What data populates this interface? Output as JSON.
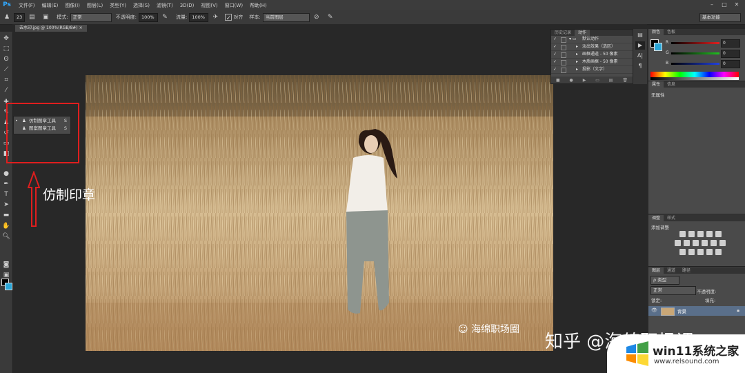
{
  "app": {
    "logo": "Ps"
  },
  "menu": [
    "文件(F)",
    "编辑(E)",
    "图像(I)",
    "图层(L)",
    "类型(Y)",
    "选择(S)",
    "滤镜(T)",
    "3D(D)",
    "视图(V)",
    "窗口(W)",
    "帮助(H)"
  ],
  "options": {
    "brush_size": "23",
    "mode_label": "模式:",
    "mode_value": "正常",
    "opacity_label": "不透明度:",
    "opacity_value": "100%",
    "flow_label": "流量:",
    "flow_value": "100%",
    "aligned_label": "对齐",
    "sample_label": "样本:",
    "sample_value": "当前图层",
    "workspace": "基本功能"
  },
  "document": {
    "tab_title": "去水印.jpg @ 100%(RGB/8#)"
  },
  "flyout": {
    "items": [
      {
        "name": "仿制图章工具",
        "key": "S",
        "selected": true
      },
      {
        "name": "图案图章工具",
        "key": "S",
        "selected": false
      }
    ]
  },
  "annotation": {
    "label": "仿制印章"
  },
  "actions_panel": {
    "tabs": [
      "历史记录",
      "动作"
    ],
    "items": [
      {
        "name": "默认动作",
        "expanded": true
      },
      {
        "name": "淡出效果（选区）"
      },
      {
        "name": "画框通道 - 50 像素"
      },
      {
        "name": "木质画框 - 50 像素"
      },
      {
        "name": "投影（文字）"
      }
    ]
  },
  "color_panel": {
    "tabs": [
      "颜色",
      "色板"
    ],
    "channels": [
      {
        "label": "R",
        "value": "0",
        "color": "#e02020"
      },
      {
        "label": "G",
        "value": "0",
        "color": "#20c020"
      },
      {
        "label": "B",
        "value": "0",
        "color": "#2040e0"
      }
    ]
  },
  "properties_panel": {
    "tabs": [
      "属性",
      "信息"
    ],
    "content": "无属性"
  },
  "adjustments_panel": {
    "tabs": [
      "调整",
      "样式"
    ],
    "title": "添加调整"
  },
  "layers_panel": {
    "tabs": [
      "图层",
      "通道",
      "路径"
    ],
    "kind_label": "ρ 类型",
    "blend_mode": "正常",
    "opacity_label": "不透明度:",
    "lock_label": "锁定:",
    "fill_label": "填充:",
    "layer_name": "背景"
  },
  "watermarks": {
    "wechat": "海绵职场圈",
    "zhihu": "知乎 @海绵职场课",
    "site_main": "win11系统之家",
    "site_url": "www.relsound.com"
  }
}
